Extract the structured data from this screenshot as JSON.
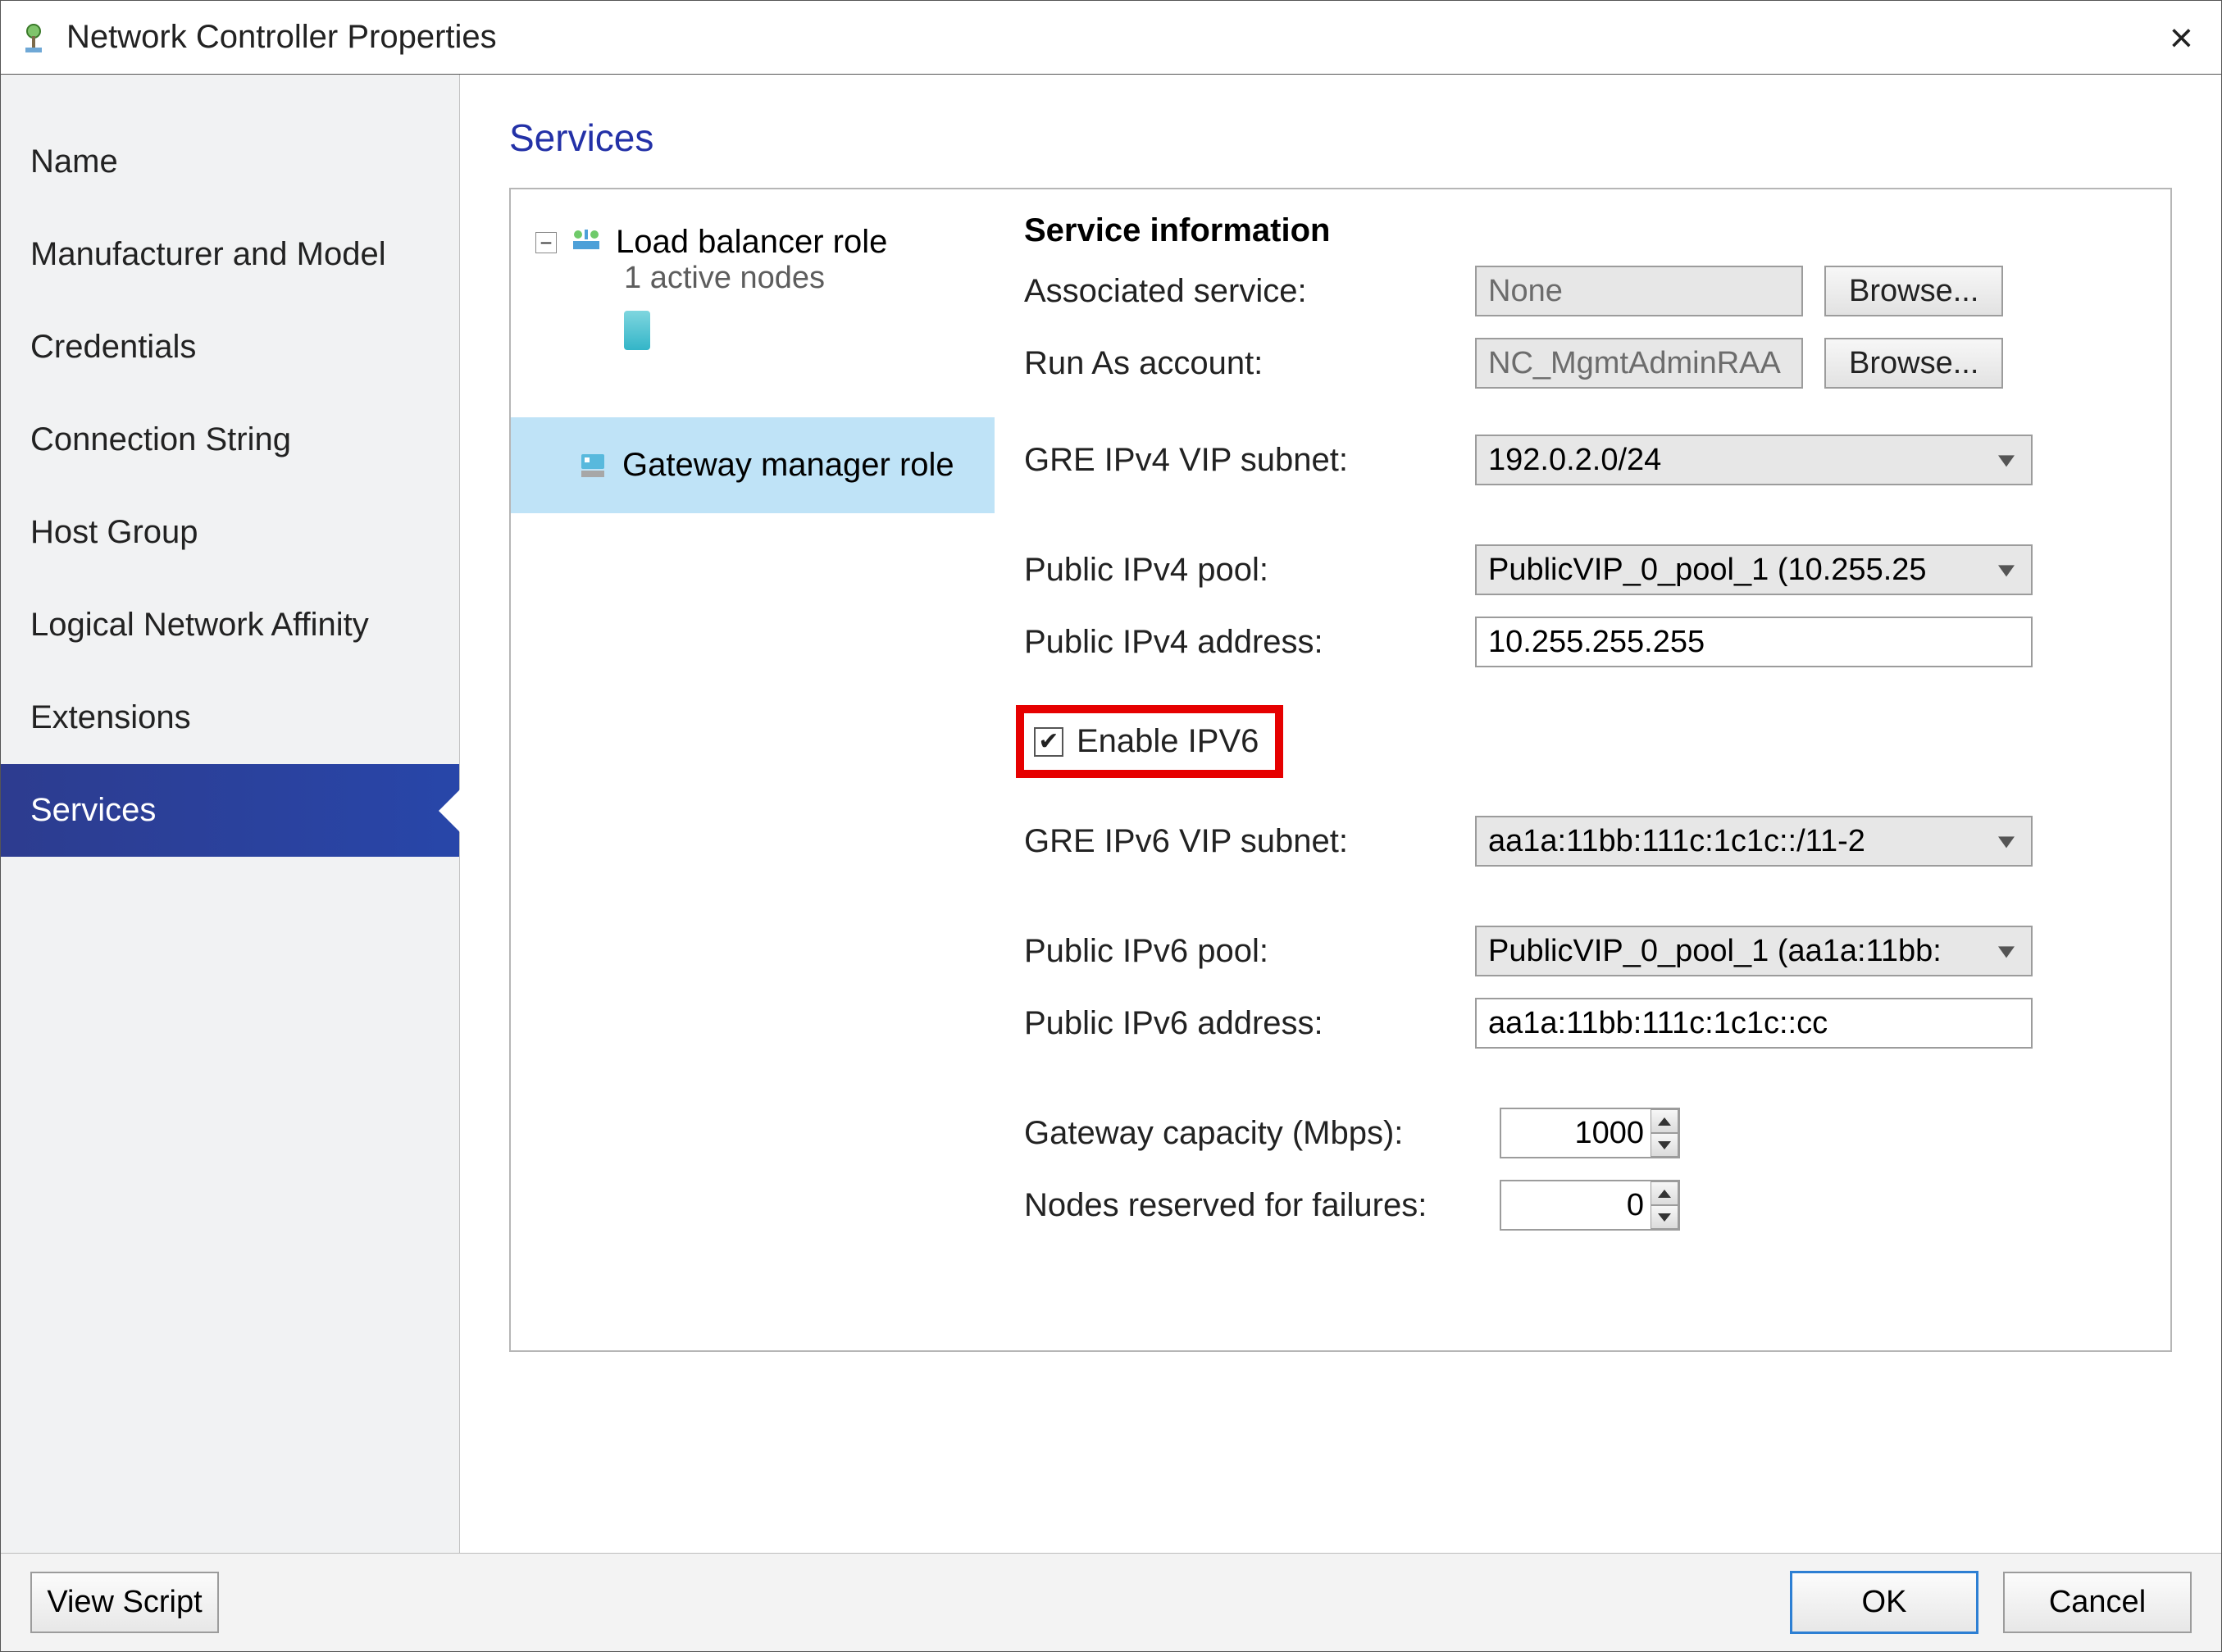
{
  "title": "Network Controller Properties",
  "sidebar": {
    "items": [
      {
        "label": "Name"
      },
      {
        "label": "Manufacturer and Model"
      },
      {
        "label": "Credentials"
      },
      {
        "label": "Connection String"
      },
      {
        "label": "Host Group"
      },
      {
        "label": "Logical Network Affinity"
      },
      {
        "label": "Extensions"
      },
      {
        "label": "Services"
      }
    ],
    "selected_index": 7
  },
  "panel": {
    "title": "Services",
    "tree": {
      "load_balancer": {
        "label": "Load balancer role",
        "subtitle": "1 active nodes"
      },
      "gateway": {
        "label": "Gateway manager role"
      }
    },
    "form": {
      "section_title": "Service information",
      "associated_service": {
        "label": "Associated service:",
        "value": "None",
        "browse": "Browse..."
      },
      "run_as": {
        "label": "Run As account:",
        "value": "NC_MgmtAdminRAA",
        "browse": "Browse..."
      },
      "gre_ipv4": {
        "label": "GRE IPv4 VIP subnet:",
        "value": "192.0.2.0/24"
      },
      "public_ipv4_pool": {
        "label": "Public IPv4 pool:",
        "value": "PublicVIP_0_pool_1 (10.255.25"
      },
      "public_ipv4_addr": {
        "label": "Public IPv4 address:",
        "value": "10.255.255.255"
      },
      "enable_ipv6": {
        "label": "Enable IPV6",
        "checked": true
      },
      "gre_ipv6": {
        "label": "GRE IPv6 VIP subnet:",
        "value": "aa1a:11bb:111c:1c1c::/11-2"
      },
      "public_ipv6_pool": {
        "label": "Public IPv6 pool:",
        "value": "PublicVIP_0_pool_1 (aa1a:11bb:"
      },
      "public_ipv6_addr": {
        "label": "Public IPv6 address:",
        "value": "aa1a:11bb:111c:1c1c::cc"
      },
      "gateway_capacity": {
        "label": "Gateway capacity (Mbps):",
        "value": "1000"
      },
      "nodes_reserved": {
        "label": "Nodes reserved for failures:",
        "value": "0"
      }
    }
  },
  "footer": {
    "view_script": "View Script",
    "ok": "OK",
    "cancel": "Cancel"
  }
}
